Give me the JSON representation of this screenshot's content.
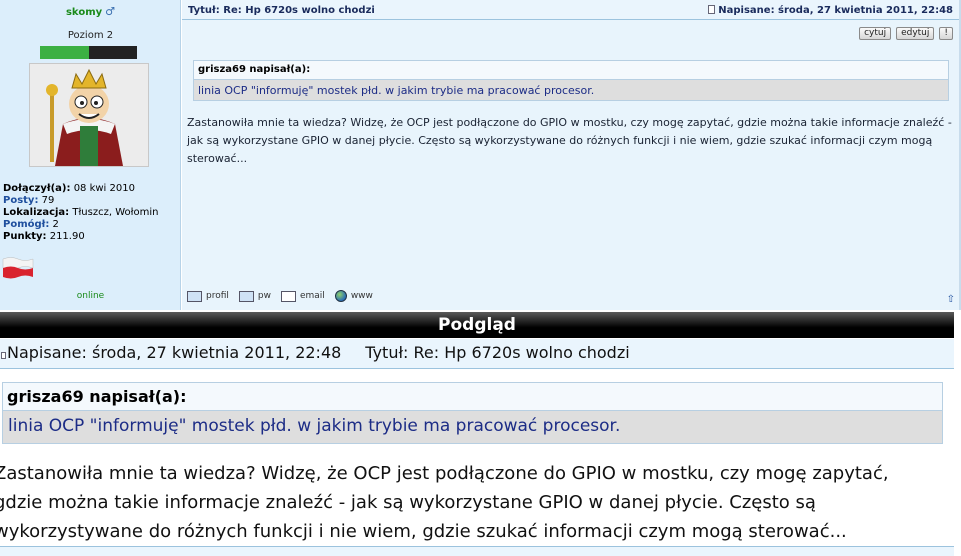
{
  "post": {
    "user": {
      "username": "skomy",
      "gender_icon": "male-symbol-icon",
      "rank": "Poziom 2",
      "rank_progress": 0.5,
      "stats": [
        {
          "label": "Dołączył(a):",
          "value": "08 kwi 2010"
        },
        {
          "label": "Posty:",
          "value": "79"
        },
        {
          "label": "Lokalizacja:",
          "value": "Tłuszcz, Wołomin"
        },
        {
          "label": "Pomógł:",
          "value": "2"
        },
        {
          "label": "Punkty:",
          "value": "211.90"
        }
      ],
      "status": "online"
    },
    "title": "Tytuł: Re: Hp 6720s wolno chodzi",
    "date": "Napisane: środa, 27 kwietnia 2011, 22:48",
    "buttons": {
      "quote": "cytuj",
      "edit": "edytuj",
      "report": "!"
    },
    "quote": {
      "author": "grisza69 napisał(a):",
      "text": "linia OCP \"informuję\" mostek płd. w jakim trybie ma pracować procesor."
    },
    "body": "Zastanowiła mnie ta wiedza? Widzę, że OCP jest podłączone do GPIO w mostku, czy mogę zapytać, gdzie można takie informacje znaleźć - jak są wykorzystane GPIO w danej płycie. Często są wykorzystywane do różnych funkcji i nie wiem, gdzie szukać informacji czym mogą sterować...",
    "links": {
      "profile": "profil",
      "pm": "pw",
      "email": "email",
      "www": "www"
    }
  },
  "preview": {
    "header": "Podgląd",
    "date": "Napisane: środa, 27 kwietnia 2011, 22:48",
    "title": "Tytuł: Re: Hp 6720s wolno chodzi",
    "quote": {
      "author": "grisza69 napisał(a):",
      "text": "linia OCP \"informuję\" mostek płd. w jakim trybie ma pracować procesor."
    },
    "body_lines": [
      "Zastanowiła mnie ta wiedza? Widzę, że OCP jest podłączone do GPIO w mostku, czy mogę zapytać,",
      "gdzie można takie informacje znaleźć - jak są wykorzystane GPIO w danej płycie. Często są",
      "wykorzystywane do różnych funkcji i nie wiem, gdzie szukać informacji czym mogą sterować..."
    ]
  }
}
